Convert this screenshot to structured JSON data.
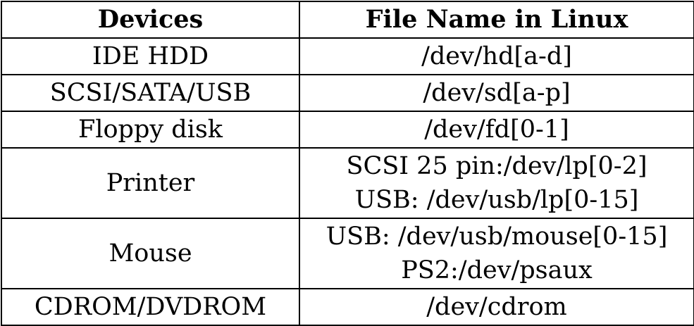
{
  "table": {
    "headers": {
      "device": "Devices",
      "file_name": "File Name in Linux"
    },
    "rows": [
      {
        "device": "IDE HDD",
        "files": [
          "/dev/hd[a-d]"
        ]
      },
      {
        "device": "SCSI/SATA/USB",
        "files": [
          "/dev/sd[a-p]"
        ]
      },
      {
        "device": "Floppy disk",
        "files": [
          "/dev/fd[0-1]"
        ]
      },
      {
        "device": "Printer",
        "files": [
          "SCSI 25 pin:/dev/lp[0-2]",
          "USB: /dev/usb/lp[0-15]"
        ]
      },
      {
        "device": "Mouse",
        "files": [
          "USB: /dev/usb/mouse[0-15]",
          "PS2:/dev/psaux"
        ]
      },
      {
        "device": "CDROM/DVDROM",
        "files": [
          "/dev/cdrom"
        ]
      }
    ]
  }
}
